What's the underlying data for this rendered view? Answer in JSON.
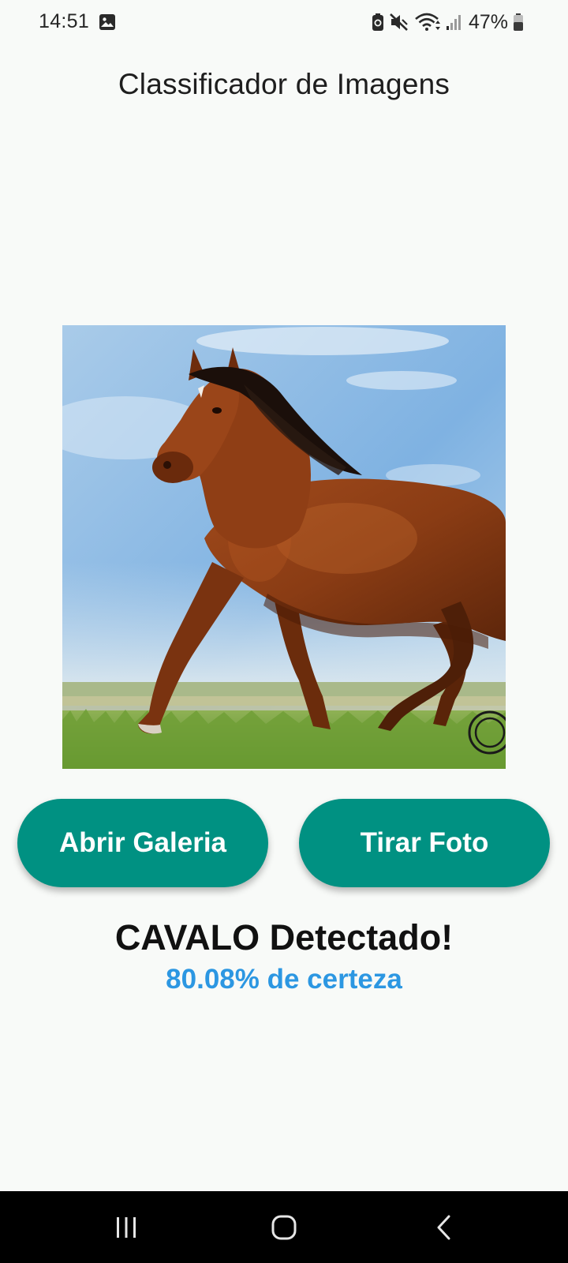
{
  "status_bar": {
    "time": "14:51",
    "battery": "47%",
    "icons": [
      "gallery-icon",
      "battery-saver-icon",
      "mute-icon",
      "wifi-icon",
      "signal-icon",
      "battery-icon"
    ]
  },
  "app": {
    "title": "Classificador de Imagens"
  },
  "preview": {
    "image": "horse-photo",
    "accent_colors": {
      "sky": "#8fbde6",
      "horse": "#8a3f17",
      "grass": "#6b9a32"
    }
  },
  "buttons": {
    "gallery_label": "Abrir Galeria",
    "camera_label": "Tirar Foto",
    "color": "#009182"
  },
  "result": {
    "label": "CAVALO Detectado!",
    "confidence": "80.08% de certeza",
    "confidence_color": "#2c97e2"
  },
  "nav_bar": {
    "icons": [
      "recents-icon",
      "home-icon",
      "back-icon"
    ]
  }
}
